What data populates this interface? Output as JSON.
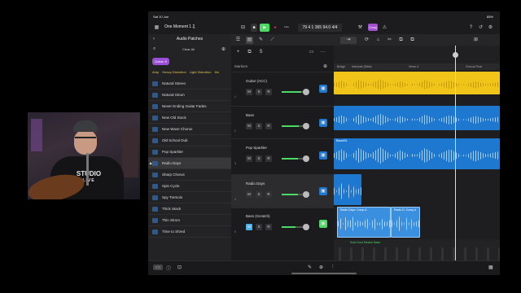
{
  "status": {
    "time": "Sat 10 Jun",
    "battery": "85%"
  },
  "song": {
    "title": "One Moment 1 2"
  },
  "lcd": {
    "position": "79 4 1 365",
    "tempo": "94.0",
    "sig": "4/4",
    "key": "Cmaj"
  },
  "transport": {
    "count_in": "¹²³⁴"
  },
  "library": {
    "title": "Audio Patches",
    "clear_all": "Clear All",
    "chip": "Guitar",
    "categories": [
      "Amp",
      "Heavy Distortion",
      "Light Distortion",
      "Mo"
    ],
    "patches": [
      "Natural Stereo",
      "Natural Strum",
      "Never Ending Guitar Fades",
      "New Old Stock",
      "New Wave Chorus",
      "Old School Dub",
      "Pop Sparkler",
      "Radio Days",
      "Sharp Chorus",
      "Spin Cycle",
      "Spy Tremolo",
      "Thick Stack",
      "Thin Strum",
      "Time to Shred"
    ],
    "selected_index": 7
  },
  "tracks": {
    "markers_label": "Markers",
    "items": [
      {
        "name": "Guitar (ACC)",
        "num": "1",
        "m": "M",
        "s": "S",
        "r": "R",
        "level": 0.85,
        "inst_color": "#1e78d0"
      },
      {
        "name": "Bass",
        "num": "2",
        "m": "M",
        "s": "S",
        "r": "R",
        "level": 0.75,
        "inst_color": "#1e78d0"
      },
      {
        "name": "Pop Sparkler",
        "num": "3",
        "m": "M",
        "s": "S",
        "r": "R",
        "level": 0.7,
        "inst_color": "#1e78d0"
      },
      {
        "name": "Radio Days",
        "num": "4",
        "m": "M",
        "s": "S",
        "r": "R",
        "level": 0.72,
        "inst_color": "#1e78d0"
      },
      {
        "name": "Bass (Scratch)",
        "num": "5",
        "m": "M",
        "s": "S",
        "r": "R",
        "level": 0.6,
        "inst_color": "#4cd964"
      }
    ]
  },
  "arrange": {
    "markers": [
      "Bridge",
      "Interlude (Slide)",
      "Verse 4",
      "Chorus Final"
    ],
    "bars": [
      "",
      "",
      "",
      ""
    ],
    "regions": {
      "bass": "Bass#01",
      "radio1": "Radio Days: Comp A",
      "radio2": "Radio D: Comp A",
      "midi": "Solid Soul Electric Bass"
    }
  },
  "colors": {
    "accent": "#4ab0e8",
    "yellow_region": "#f0c419",
    "blue_region": "#1e78d0"
  }
}
